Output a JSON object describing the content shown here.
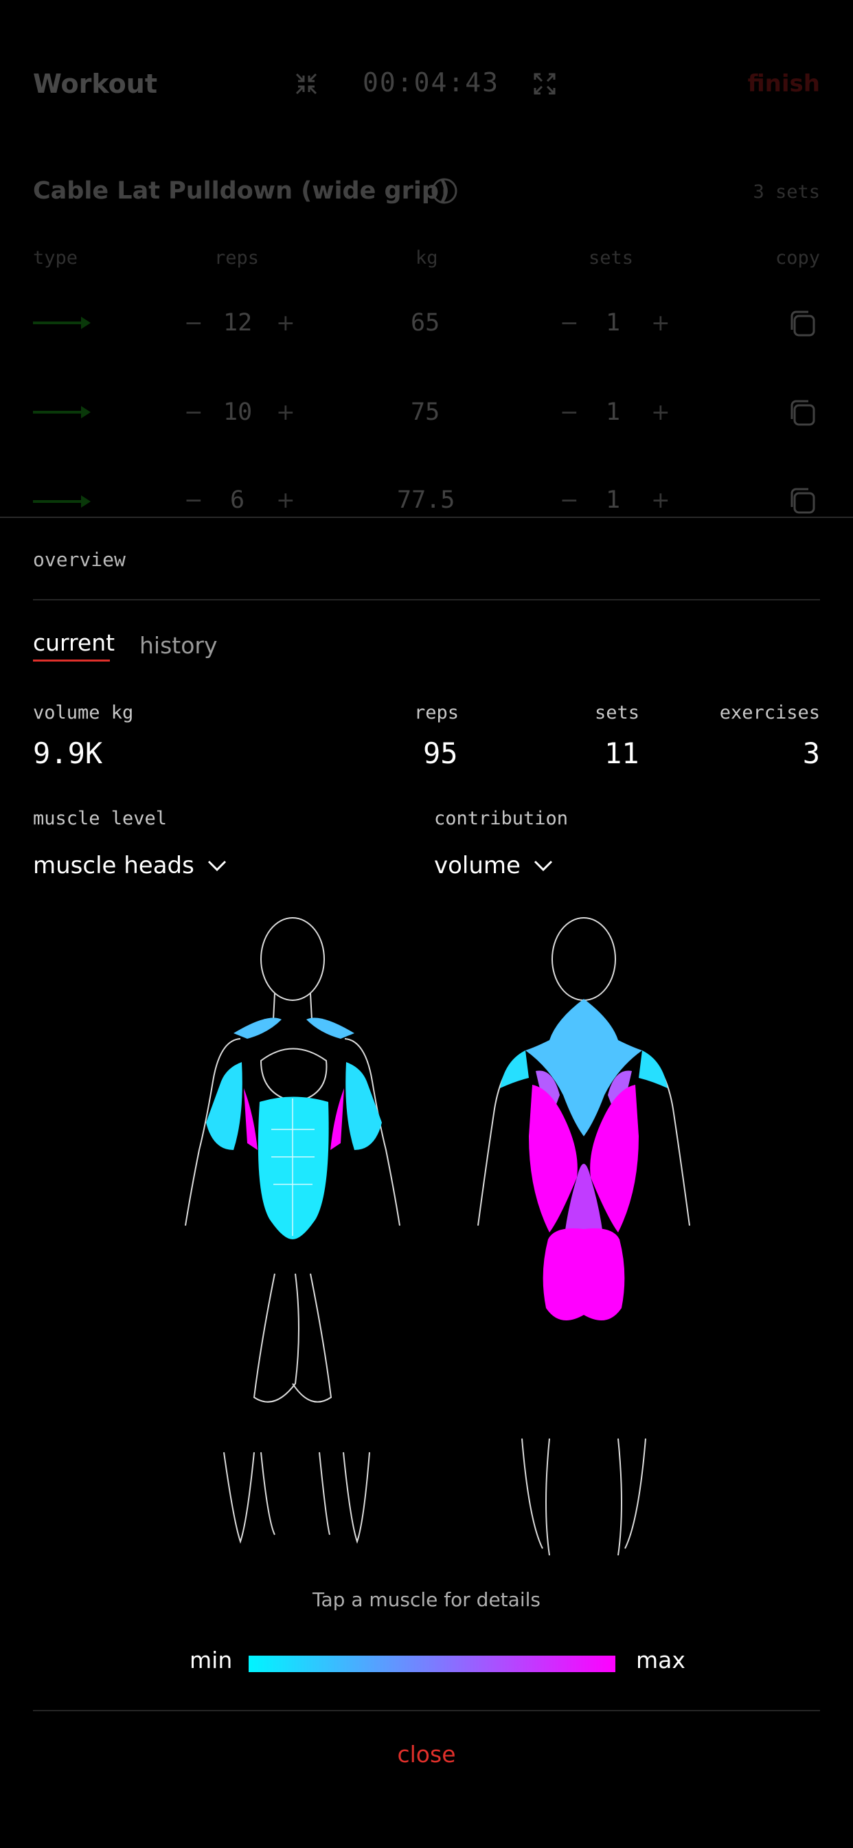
{
  "header": {
    "title": "Workout",
    "timer": "00:04:43",
    "finish": "finish"
  },
  "exercise": {
    "name": "Cable Lat Pulldown (wide grip)",
    "sets_count": "3 sets",
    "columns": [
      "type",
      "reps",
      "kg",
      "sets",
      "copy"
    ],
    "rows": [
      {
        "reps": "12",
        "kg": "65",
        "sets": "1"
      },
      {
        "reps": "10",
        "kg": "75",
        "sets": "1"
      },
      {
        "reps": "6",
        "kg": "77.5",
        "sets": "1"
      }
    ],
    "minus": "−",
    "plus": "+"
  },
  "overview": {
    "title": "overview",
    "tabs": {
      "current": "current",
      "history": "history"
    },
    "stats": {
      "volume_label": "volume kg",
      "volume": "9.9K",
      "reps_label": "reps",
      "reps": "95",
      "sets_label": "sets",
      "sets": "11",
      "exercises_label": "exercises",
      "exercises": "3"
    },
    "muscle_level": {
      "label": "muscle level",
      "value": "muscle heads"
    },
    "contribution": {
      "label": "contribution",
      "value": "volume"
    },
    "hint": "Tap a muscle for details",
    "legend": {
      "min": "min",
      "max": "max"
    },
    "close": "close"
  },
  "colors": {
    "low": "#00f5ff",
    "mid": "#4fc3ff",
    "high": "#ff00ff",
    "accent": "#e0302b",
    "set_type": "#1aa21a"
  }
}
